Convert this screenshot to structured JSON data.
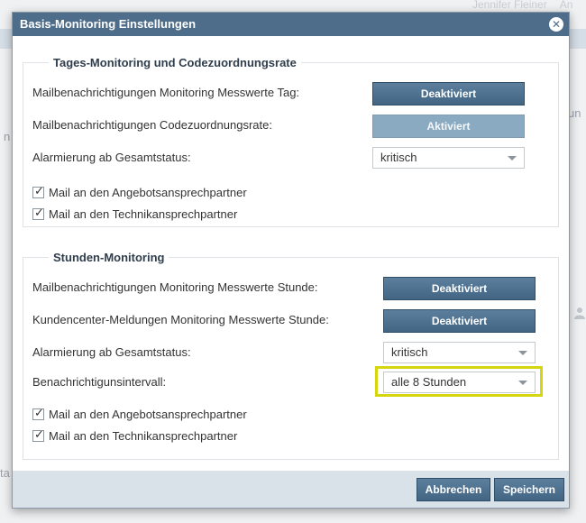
{
  "background": {
    "user": "Jennifer Fleiner",
    "user_tail": "An",
    "frag_right": "un",
    "frag_left": "n",
    "frag_bottom": "ta"
  },
  "dialog": {
    "title": "Basis-Monitoring Einstellungen",
    "close_icon": "close-icon",
    "sections": {
      "tages": {
        "legend": "Tages-Monitoring und Codezuordnungsrate",
        "mail_messwerte_label": "Mailbenachrichtigungen Monitoring Messwerte Tag:",
        "mail_messwerte_button": "Deaktiviert",
        "mail_code_label": "Mailbenachrichtigungen Codezuordnungsrate:",
        "mail_code_button": "Aktiviert",
        "alarm_label": "Alarmierung ab Gesamtstatus:",
        "alarm_value": "kritisch",
        "chk_angebot": "Mail an den Angebotsansprechpartner",
        "chk_technik": "Mail an den Technikansprechpartner"
      },
      "stunden": {
        "legend": "Stunden-Monitoring",
        "mail_messwerte_label": "Mailbenachrichtigungen Monitoring Messwerte Stunde:",
        "mail_messwerte_button": "Deaktiviert",
        "kundencenter_label": "Kundencenter-Meldungen Monitoring Messwerte Stunde:",
        "kundencenter_button": "Deaktiviert",
        "alarm_label": "Alarmierung ab Gesamtstatus:",
        "alarm_value": "kritisch",
        "intervall_label": "Benachrichtigunsintervall:",
        "intervall_value": "alle 8 Stunden",
        "chk_angebot": "Mail an den Angebotsansprechpartner",
        "chk_technik": "Mail an den Technikansprechpartner"
      }
    },
    "footer": {
      "cancel": "Abbrechen",
      "save": "Speichern"
    }
  },
  "colors": {
    "titlebar": "#4e6d8a",
    "button": "#4a6e8c",
    "button_inactive": "#8aaac2",
    "highlight": "#d5d60e",
    "footer": "#d9e1e9"
  }
}
